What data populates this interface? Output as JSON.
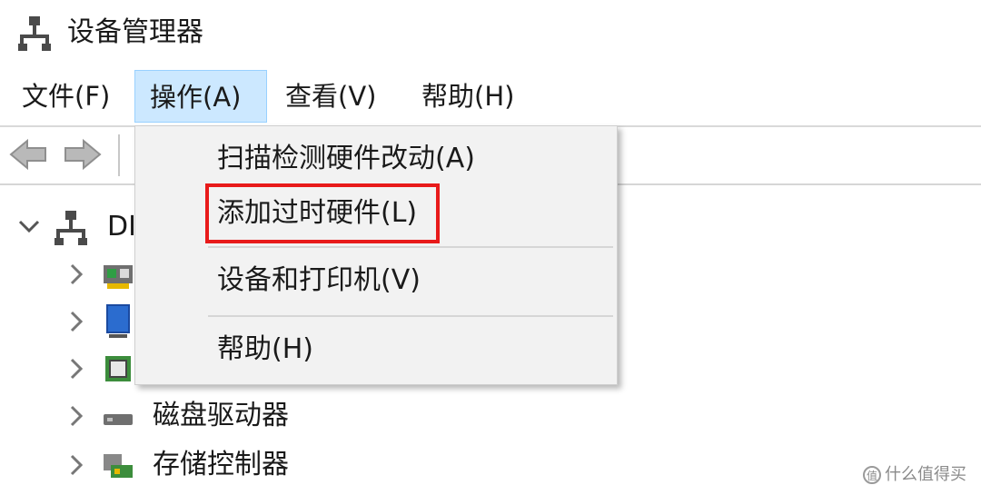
{
  "window": {
    "title": "设备管理器",
    "icon": "computer-network-icon"
  },
  "menubar": {
    "items": [
      {
        "label": "文件(F)",
        "active": false
      },
      {
        "label": "操作(A)",
        "active": true
      },
      {
        "label": "查看(V)",
        "active": false
      },
      {
        "label": "帮助(H)",
        "active": false
      }
    ]
  },
  "toolbar": {
    "back_icon": "back-arrow-icon",
    "forward_icon": "forward-arrow-icon"
  },
  "tree": {
    "root_label": "DI",
    "items": [
      {
        "label": "",
        "icon": "network-card-icon"
      },
      {
        "label": "",
        "icon": "monitor-icon"
      },
      {
        "label": "",
        "icon": "processor-icon"
      },
      {
        "label": "磁盘驱动器",
        "icon": "disk-drive-icon"
      },
      {
        "label": "存储控制器",
        "icon": "storage-controller-icon"
      }
    ]
  },
  "dropdown": {
    "items": [
      {
        "label": "扫描检测硬件改动(A)"
      },
      {
        "label": "添加过时硬件(L)",
        "highlighted": true
      },
      {
        "label": "设备和打印机(V)"
      },
      {
        "label": "帮助(H)"
      }
    ],
    "highlight_color": "#e81a1a"
  },
  "colors": {
    "menu_active_bg": "#cce8ff",
    "menu_active_border": "#99d1ff",
    "menu_bg": "#f2f2f2"
  },
  "watermark": {
    "text": "什么值得买",
    "icon_glyph": "值"
  }
}
